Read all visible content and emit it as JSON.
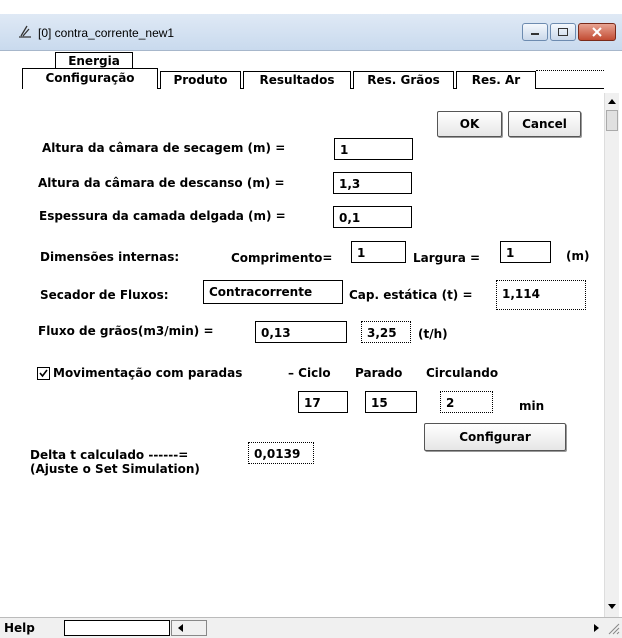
{
  "window": {
    "title": "[0]  contra_corrente_new1"
  },
  "tabs": {
    "top": "Energia",
    "bottom": [
      "Configuração",
      "Produto",
      "Resultados",
      "Res. Grãos",
      "Res. Ar"
    ]
  },
  "buttons": {
    "ok": "OK",
    "cancel": "Cancel",
    "configurar": "Configurar"
  },
  "fields": {
    "altura_secagem": {
      "label": "Altura da câmara de secagem (m) =",
      "value": "1"
    },
    "altura_descanso": {
      "label": "Altura da câmara de descanso (m) =",
      "value": "1,3"
    },
    "espessura": {
      "label": "Espessura da camada delgada (m) =",
      "value": "0,1"
    }
  },
  "dimensoes": {
    "label": "Dimensões internas:",
    "comprimento_label": "Comprimento=",
    "comprimento_value": "1",
    "largura_label": "Largura =",
    "largura_value": "1",
    "unit": "(m)"
  },
  "secador": {
    "label": "Secador de Fluxos:",
    "value": "Contracorrente",
    "cap_label": "Cap. estática (t) =",
    "cap_value": "1,114"
  },
  "fluxo": {
    "label": "Fluxo de grãos(m3/min) =",
    "value": "0,13",
    "th_value": "3,25",
    "th_unit": "(t/h)"
  },
  "movimentacao": {
    "checkbox_label": "Movimentação com paradas",
    "checked": true,
    "ciclo_label": "– Ciclo",
    "parado_label": "Parado",
    "circulando_label": "Circulando",
    "ciclo_value": "17",
    "parado_value": "15",
    "circulando_value": "2",
    "unit": "min"
  },
  "delta": {
    "label": "Delta t calculado  ------=",
    "value": "0,0139",
    "note": "(Ajuste o Set Simulation)"
  },
  "status": {
    "help": "Help"
  }
}
